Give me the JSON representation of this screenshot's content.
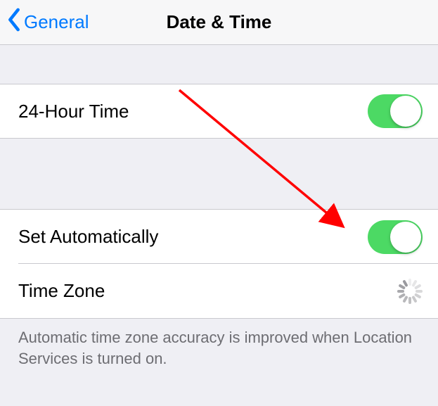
{
  "navbar": {
    "back_label": "General",
    "title": "Date & Time"
  },
  "rows": {
    "twenty_four_hour": {
      "label": "24-Hour Time",
      "on": true
    },
    "set_automatically": {
      "label": "Set Automatically",
      "on": true
    },
    "time_zone": {
      "label": "Time Zone",
      "loading": true
    }
  },
  "footer": "Automatic time zone accuracy is improved when Location Services is turned on.",
  "colors": {
    "accent": "#007aff",
    "toggle_on": "#4cd964"
  }
}
